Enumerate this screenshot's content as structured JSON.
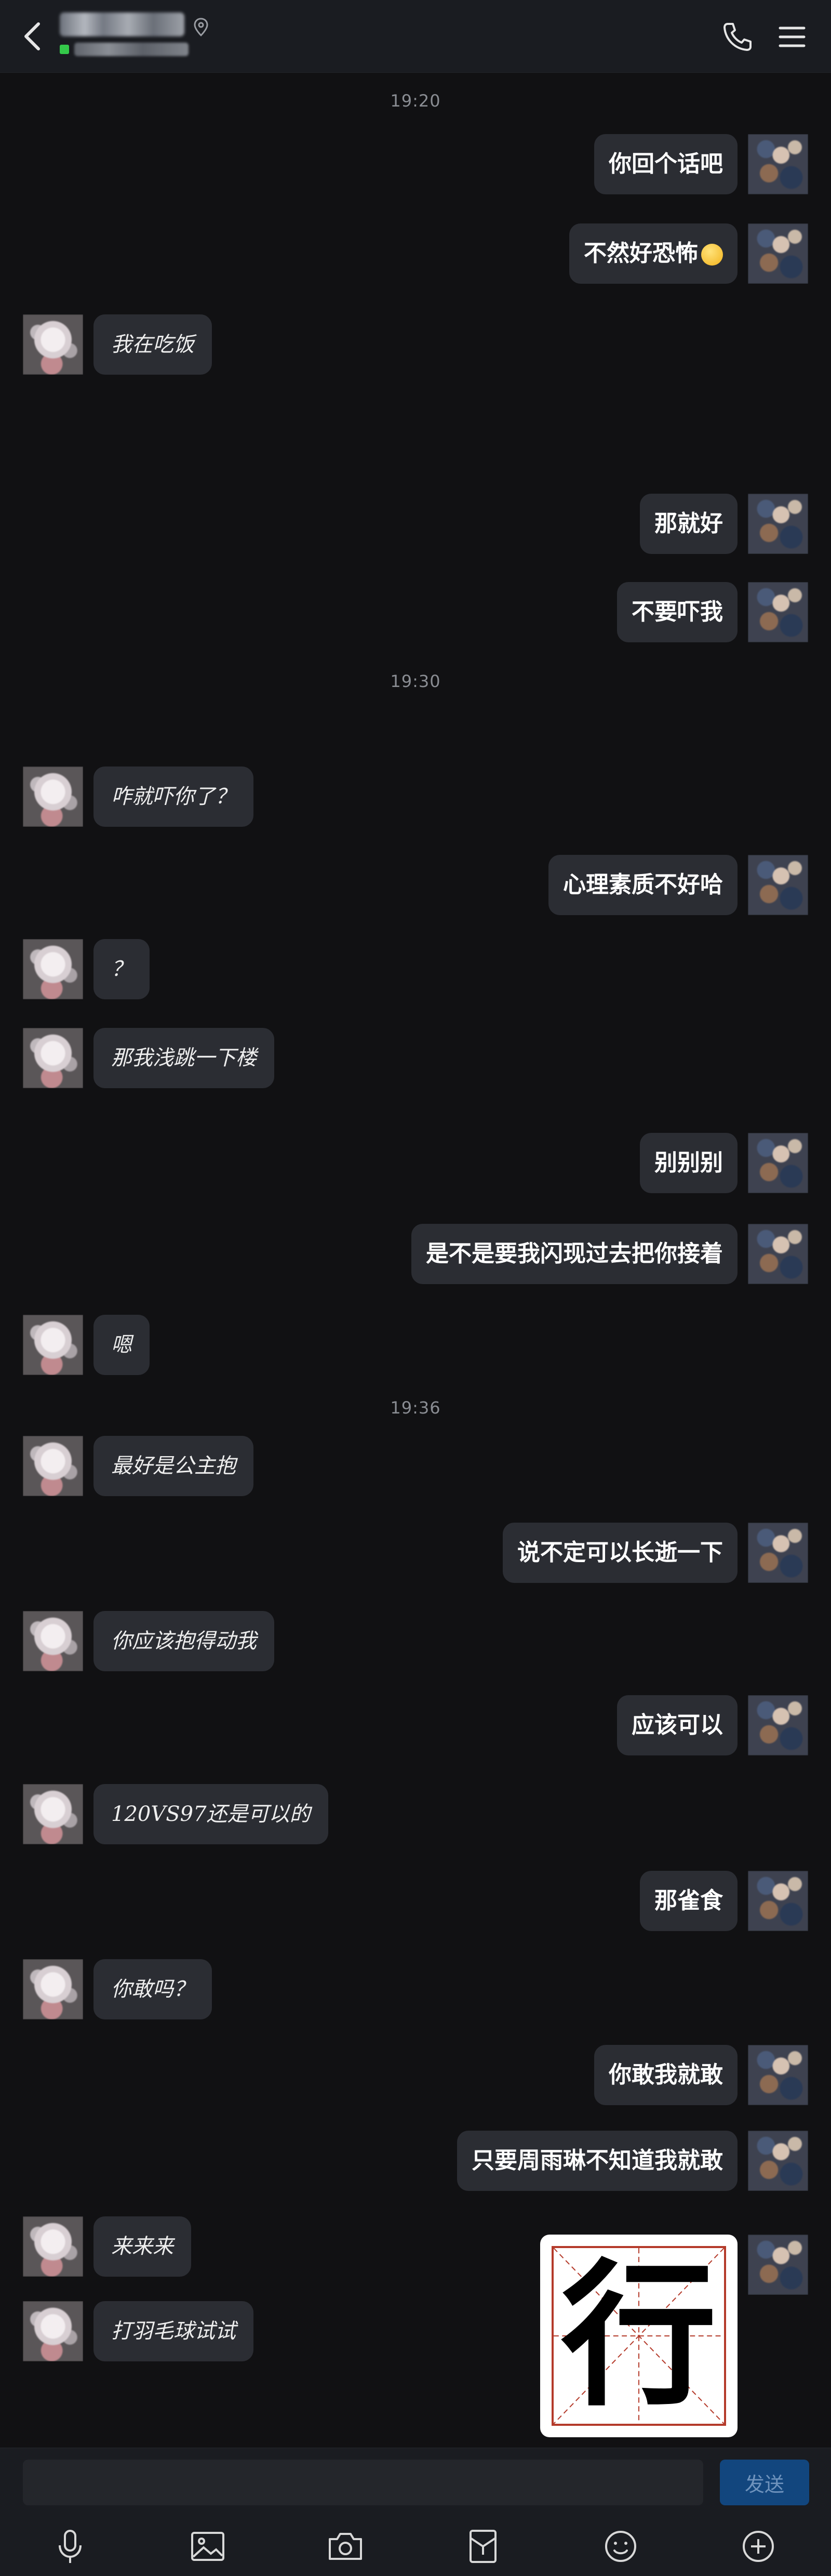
{
  "header": {
    "contact_name": "■■■■■",
    "status_text": "■■■■■■■",
    "accent": "#34c84a"
  },
  "messages": [
    {
      "type": "time",
      "text": "19:20"
    },
    {
      "type": "msg",
      "side": "right",
      "text": "你回个话吧"
    },
    {
      "type": "msg",
      "side": "right",
      "text": "不然好恐怖",
      "emoji": "face-emoji"
    },
    {
      "type": "msg",
      "side": "left",
      "text": "我在吃饭"
    },
    {
      "type": "msg",
      "side": "right",
      "text": "那就好"
    },
    {
      "type": "msg",
      "side": "right",
      "text": "不要吓我"
    },
    {
      "type": "time",
      "text": "19:30"
    },
    {
      "type": "msg",
      "side": "left",
      "text": "咋就吓你了？"
    },
    {
      "type": "msg",
      "side": "right",
      "text": "心理素质不好哈"
    },
    {
      "type": "msg",
      "side": "left",
      "text": "？"
    },
    {
      "type": "msg",
      "side": "left",
      "text": "那我浅跳一下楼"
    },
    {
      "type": "msg",
      "side": "right",
      "text": "别别别"
    },
    {
      "type": "msg",
      "side": "right",
      "text": "是不是要我闪现过去把你接着"
    },
    {
      "type": "msg",
      "side": "left",
      "text": "嗯"
    },
    {
      "type": "time",
      "text": "19:36"
    },
    {
      "type": "msg",
      "side": "left",
      "text": "最好是公主抱"
    },
    {
      "type": "msg",
      "side": "right",
      "text": "说不定可以长逝一下"
    },
    {
      "type": "msg",
      "side": "left",
      "text": "你应该抱得动我"
    },
    {
      "type": "msg",
      "side": "right",
      "text": "应该可以"
    },
    {
      "type": "msg",
      "side": "left",
      "text": "120VS97还是可以的"
    },
    {
      "type": "msg",
      "side": "right",
      "text": "那雀食"
    },
    {
      "type": "msg",
      "side": "left",
      "text": "你敢吗？"
    },
    {
      "type": "msg",
      "side": "right",
      "text": "你敢我就敢"
    },
    {
      "type": "msg",
      "side": "right",
      "text": "只要周雨琳不知道我就敢"
    },
    {
      "type": "msg",
      "side": "left",
      "text": "来来来"
    },
    {
      "type": "msg",
      "side": "left",
      "text": "打羽毛球试试"
    },
    {
      "type": "sticker",
      "side": "right",
      "char": "行"
    }
  ],
  "input": {
    "value": "",
    "placeholder": "",
    "send_label": "发送"
  },
  "toolbar_icons": [
    "mic-icon",
    "image-icon",
    "camera-icon",
    "red-packet-icon",
    "emoji-icon",
    "plus-icon"
  ],
  "colors": {
    "background": "#111113",
    "bubble": "#2b2d33",
    "send_button": "#12467e"
  }
}
